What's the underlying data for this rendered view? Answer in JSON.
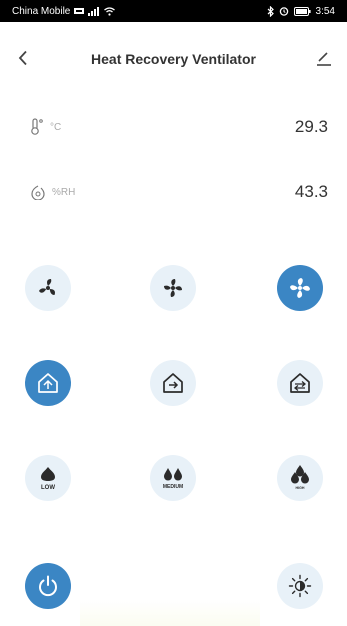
{
  "status_bar": {
    "carrier": "China Mobile",
    "time": "3:54"
  },
  "header": {
    "title": "Heat Recovery Ventilator"
  },
  "readings": {
    "temperature": {
      "unit": "°C",
      "value": "29.3",
      "icon": "thermometer-icon"
    },
    "humidity": {
      "unit": "%RH",
      "value": "43.3",
      "icon": "humidity-drop-icon"
    }
  },
  "controls": {
    "fan_speed_row": [
      "fan-low-icon",
      "fan-medium-icon",
      "fan-high-icon"
    ],
    "mode_row": [
      "home-mode-icon",
      "away-mode-icon",
      "auto-mode-icon"
    ],
    "humidity_row": [
      {
        "icon": "humidity-low-icon",
        "label": "LOW"
      },
      {
        "icon": "humidity-medium-icon",
        "label": "MEDIUM"
      },
      {
        "icon": "humidity-high-icon",
        "label": "HIGH"
      }
    ],
    "active": [
      "fan-high",
      "home-mode",
      "power"
    ]
  },
  "colors": {
    "accent": "#3b86c4",
    "inactive_bg": "#e8f1f8",
    "icon_dark": "#2b2b2b"
  }
}
